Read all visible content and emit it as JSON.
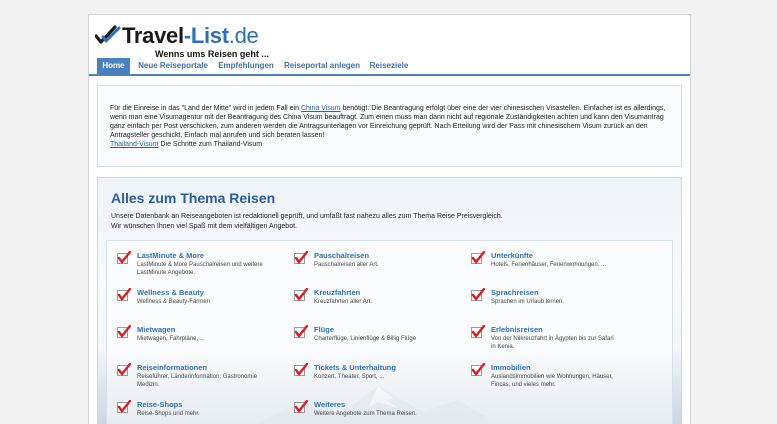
{
  "logo": {
    "part1": "Travel",
    "part2": "-List",
    "part3": ".de",
    "slogan": "Wenns ums Reisen geht ..."
  },
  "nav": {
    "items": [
      "Home",
      "Neue Reiseportale",
      "Empfehlungen",
      "Reiseportal anlegen",
      "Reiseziele"
    ]
  },
  "info": {
    "text1": "Für die Einreise in das \"Land der Mitte\" wird in jedem Fall ein ",
    "link1": "China Visum",
    "text2": " benötigt. Die Beantragung erfolgt über eine der vier chinesischen Visastellen. Einfacher ist es allerdings, wenn man eine Visumagentur mit der Beantragung des China Visum beauftragt. Zum einen muss man dann nicht auf regionale Zuständigkeiten achten und kann den Visumantrag ganz einfach per Post verschicken, zum anderen werden die Antragsunterlagen vor Einreichung geprüft. Nach Erteilung wird der Pass mit chinesischem Visum zurück an den Antragsteller geschickt. Einfach mal anrufen und sich beraten lassen!",
    "link2": "Thailand-Visum",
    "text3": " Die Schritte zum Thailand-Visum"
  },
  "main": {
    "title": "Alles zum Thema Reisen",
    "intro1": "Unsere Datenbank an Reiseangeboten ist redaktionell geprüft, und umfaßt fast nahezu alles zum Thema Reise Preisvergleich.",
    "intro2": "Wir wünschen Ihnen viel Spaß mit dem vielfältigen Angebot."
  },
  "categories": [
    {
      "title": "LastMinute & More",
      "desc": "LastMinute & More Pauschalreisen und weitere LastMinute Angebote."
    },
    {
      "title": "Pauschalreisen",
      "desc": "Pauschalreisen aller Art."
    },
    {
      "title": "Unterkünfte",
      "desc": "Hotels, Ferienhäuser, Ferienwohnungen, ..."
    },
    {
      "title": "Wellness & Beauty",
      "desc": "Wellness & Beauty-Farmen"
    },
    {
      "title": "Kreuzfahrten",
      "desc": "Kreuzfahrten aller Art."
    },
    {
      "title": "Sprachreisen",
      "desc": "Sprachen im Urlaub lernen."
    },
    {
      "title": "Mietwagen",
      "desc": "Mietwagen, Fahrpläne, ..."
    },
    {
      "title": "Flüge",
      "desc": "Charterflüge, Linienflüge & Billig Flüge"
    },
    {
      "title": "Erlebnisreisen",
      "desc": "Von der Nilkreuzfahrt in Ägypten bis zur Safari in Kenia."
    },
    {
      "title": "Reiseinformationen",
      "desc": "Reiseführer, Länderinformation, Gastronomie Medizin."
    },
    {
      "title": "Tickets & Unterhaltung",
      "desc": "Konzert, Theater, Sport, ..."
    },
    {
      "title": "Immobilien",
      "desc": "Auslandsimmobilien wie Wohnungen, Häuser, Fincas, und vieles mehr."
    },
    {
      "title": "Reise-Shops",
      "desc": "Reise-Shops und mehr."
    },
    {
      "title": "Weiteres",
      "desc": "Weitere Angebote zum Thema Reisen."
    }
  ],
  "colors": {
    "accent": "#4a82c0",
    "link": "#2f6fb4",
    "check": "#d42020"
  }
}
